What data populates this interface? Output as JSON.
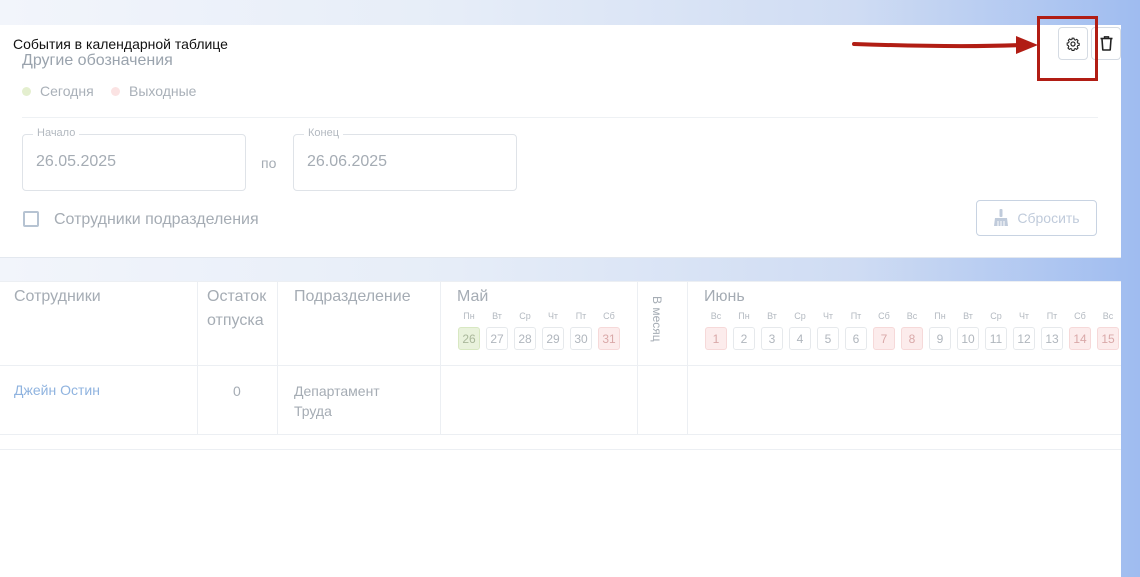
{
  "header": {
    "title": "События в календарной таблице",
    "subtitle": "Другие обозначения"
  },
  "legend": [
    {
      "label": "Сегодня",
      "color": "#e4efcf"
    },
    {
      "label": "Выходные",
      "color": "#fbe3e3"
    }
  ],
  "filters": {
    "start": {
      "legend": "Начало",
      "value": "26.05.2025"
    },
    "separator": "по",
    "end": {
      "legend": "Конец",
      "value": "26.06.2025"
    },
    "checkbox_label": "Сотрудники подразделения",
    "checkbox_checked": false,
    "reset_label": "Сбросить"
  },
  "toolbar": {
    "settings_icon": "gear-icon",
    "delete_icon": "trash-icon",
    "highlight_color": "#b11d14"
  },
  "table": {
    "columns": {
      "employees": "Сотрудники",
      "vacation_line1": "Остаток",
      "vacation_line2": "отпуска",
      "department": "Подразделение",
      "per_month": "В месяц"
    },
    "months": [
      {
        "name": "Май",
        "days": [
          {
            "wd": "Пн",
            "n": "26",
            "state": "today"
          },
          {
            "wd": "Вт",
            "n": "27",
            "state": ""
          },
          {
            "wd": "Ср",
            "n": "28",
            "state": ""
          },
          {
            "wd": "Чт",
            "n": "29",
            "state": ""
          },
          {
            "wd": "Пт",
            "n": "30",
            "state": ""
          },
          {
            "wd": "Сб",
            "n": "31",
            "state": "weekend"
          }
        ]
      },
      {
        "name": "Июнь",
        "days": [
          {
            "wd": "Вс",
            "n": "1",
            "state": "weekend"
          },
          {
            "wd": "Пн",
            "n": "2",
            "state": ""
          },
          {
            "wd": "Вт",
            "n": "3",
            "state": ""
          },
          {
            "wd": "Ср",
            "n": "4",
            "state": ""
          },
          {
            "wd": "Чт",
            "n": "5",
            "state": ""
          },
          {
            "wd": "Пт",
            "n": "6",
            "state": ""
          },
          {
            "wd": "Сб",
            "n": "7",
            "state": "weekend"
          },
          {
            "wd": "Вс",
            "n": "8",
            "state": "weekend"
          },
          {
            "wd": "Пн",
            "n": "9",
            "state": ""
          },
          {
            "wd": "Вт",
            "n": "10",
            "state": ""
          },
          {
            "wd": "Ср",
            "n": "11",
            "state": ""
          },
          {
            "wd": "Чт",
            "n": "12",
            "state": ""
          },
          {
            "wd": "Пт",
            "n": "13",
            "state": ""
          },
          {
            "wd": "Сб",
            "n": "14",
            "state": "weekend"
          },
          {
            "wd": "Вс",
            "n": "15",
            "state": "weekend"
          }
        ]
      }
    ],
    "rows": [
      {
        "employee": "Джейн Остин",
        "vacation": "0",
        "department_line1": "Департамент",
        "department_line2": "Труда"
      }
    ]
  }
}
